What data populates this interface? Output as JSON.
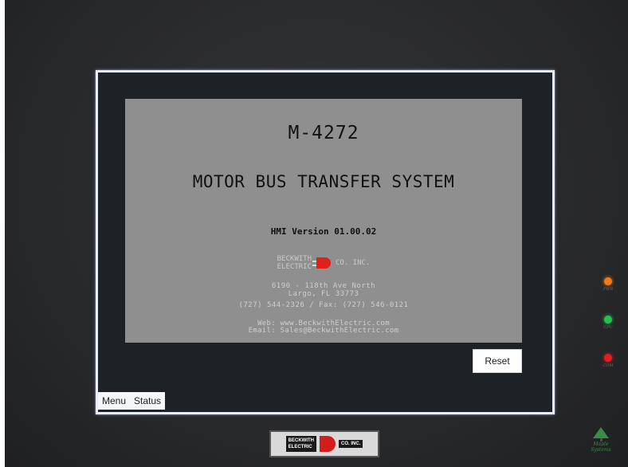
{
  "hmi": {
    "model": "M-4272",
    "title": "MOTOR BUS TRANSFER SYSTEM",
    "version": "HMI Version 01.00.02",
    "company": {
      "line1": "BECKWITH",
      "line2": "ELECTRIC",
      "suffix": "CO. INC."
    },
    "address": {
      "line1": "6190 - 118th Ave North",
      "line2": "Largo, FL 33773"
    },
    "phone": "(727) 544-2326 / Fax: (727) 546-0121",
    "web": "Web: www.BeckwithElectric.com",
    "email": "Email: Sales@BeckwithElectric.com"
  },
  "buttons": {
    "reset": "Reset"
  },
  "tabs": [
    {
      "label": "Menu"
    },
    {
      "label": "Status"
    }
  ],
  "leds": [
    {
      "label": "PWR",
      "color": "#f07a1c"
    },
    {
      "label": "CPU",
      "color": "#27c24b"
    },
    {
      "label": "COM",
      "color": "#e0201b"
    }
  ],
  "bezel_brand": {
    "line1": "BECKWITH",
    "line2": "ELECTRIC",
    "suffix": "CO. INC."
  },
  "maple_logo": {
    "line1": "Maple",
    "line2": "Systems"
  }
}
